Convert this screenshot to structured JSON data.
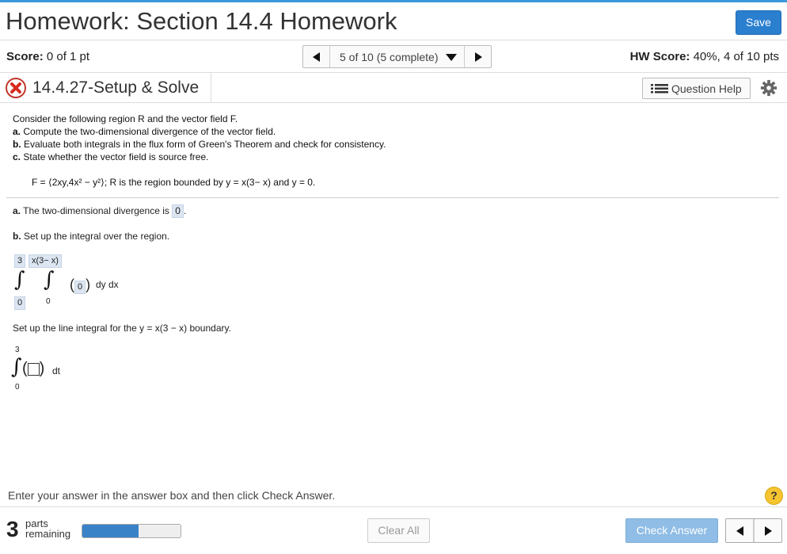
{
  "header": {
    "title": "Homework: Section 14.4 Homework",
    "save_label": "Save"
  },
  "score_bar": {
    "score_label": "Score:",
    "score_value": "0 of 1 pt",
    "nav_label": "5 of 10 (5 complete)",
    "hw_score_label": "HW Score:",
    "hw_score_value": "40%, 4 of 10 pts"
  },
  "question": {
    "title": "14.4.27-Setup & Solve",
    "help_label": "Question Help"
  },
  "problem": {
    "intro": "Consider the following region R and the vector field F.",
    "part_a_label": "a.",
    "part_a": "Compute the two-dimensional divergence of the vector field.",
    "part_b_label": "b.",
    "part_b": "Evaluate both integrals in the flux form of Green's Theorem and check for consistency.",
    "part_c_label": "c.",
    "part_c": "State whether the vector field is source free.",
    "formula": "F = ⟨2xy,4x² − y²⟩; R is the region bounded by y = x(3− x) and y = 0."
  },
  "answers": {
    "a_label": "a.",
    "a_text": "The two-dimensional divergence is",
    "a_value": "0",
    "a_end": ".",
    "b_label": "b.",
    "b_text": "Set up the integral over the region.",
    "outer_upper": "3",
    "inner_upper": "x(3− x)",
    "outer_lower": "0",
    "inner_lower": "0",
    "integrand": "0",
    "differentials": "dy dx",
    "line_text": "Set up the line integral for the y = x(3 − x) boundary.",
    "line_upper": "3",
    "line_lower": "0",
    "line_diff": "dt"
  },
  "footer": {
    "instruction": "Enter your answer in the answer box and then click Check Answer.",
    "help_symbol": "?",
    "parts_num": "3",
    "parts_label_1": "parts",
    "parts_label_2": "remaining",
    "progress_fraction": 0.57,
    "clear_label": "Clear All",
    "check_label": "Check Answer"
  },
  "colors": {
    "accent": "#2a7fcf",
    "progress": "#3a82c8",
    "answer_box": "#dce6f2",
    "check_disabled": "#8fbde6"
  },
  "icons": [
    "x-icon",
    "list-icon",
    "gear-icon",
    "prev-arrow-icon",
    "next-arrow-icon",
    "chevron-down-icon",
    "help-icon"
  ]
}
